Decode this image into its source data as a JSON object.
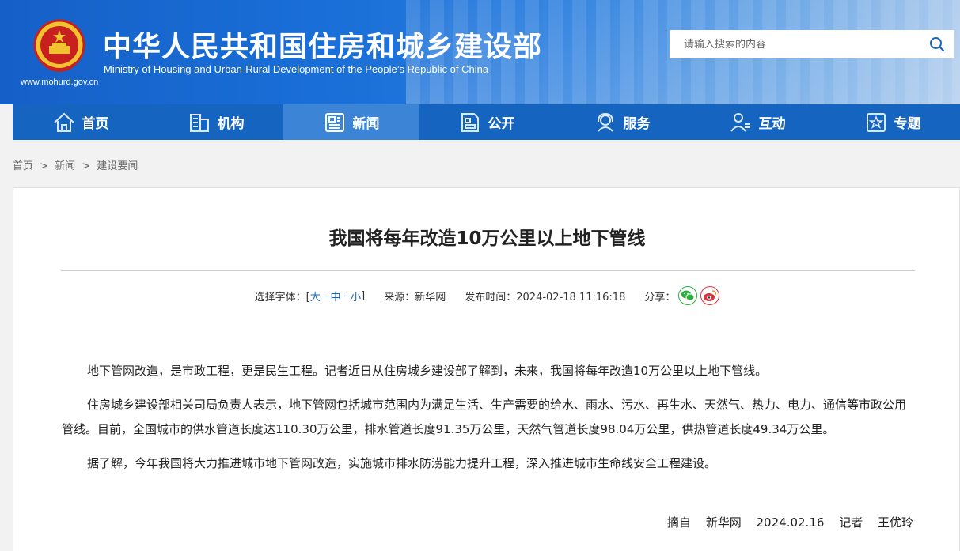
{
  "header": {
    "title_cn": "中华人民共和国住房和城乡建设部",
    "title_en": "Ministry of Housing and Urban-Rural Development of the People’s Republic of China",
    "url": "www.mohurd.gov.cn",
    "emblem_icon": "national-emblem-icon",
    "search_placeholder": "请输入搜索的内容",
    "search_icon": "search-icon"
  },
  "nav": {
    "items": [
      {
        "label": "首页",
        "icon": "home-icon"
      },
      {
        "label": "机构",
        "icon": "building-icon"
      },
      {
        "label": "新闻",
        "icon": "news-icon",
        "active": true
      },
      {
        "label": "公开",
        "icon": "document-icon"
      },
      {
        "label": "服务",
        "icon": "service-icon"
      },
      {
        "label": "互动",
        "icon": "interaction-icon"
      },
      {
        "label": "专题",
        "icon": "topic-icon"
      }
    ]
  },
  "breadcrumb": {
    "items": [
      "首页",
      "新闻",
      "建设要闻"
    ],
    "separator": ">"
  },
  "article": {
    "title": "我国将每年改造10万公里以上地下管线",
    "font_label": "选择字体：[",
    "font_large": "大",
    "font_medium": "中",
    "font_small": "小",
    "font_dash": "-",
    "font_close": "]",
    "source": "来源：新华网",
    "publish_time": "发布时间：2024-02-18 11:16:18",
    "share_label": "分享：",
    "paragraphs": [
      "地下管网改造，是市政工程，更是民生工程。记者近日从住房城乡建设部了解到，未来，我国将每年改造10万公里以上地下管线。",
      "住房城乡建设部相关司局负责人表示，地下管网包括城市范围内为满足生活、生产需要的给水、雨水、污水、再生水、天然气、热力、电力、通信等市政公用管线。目前，全国城市的供水管道长度达110.30万公里，排水管道长度91.35万公里，天然气管道长度98.04万公里，供热管道长度49.34万公里。",
      "据了解，今年我国将大力推进城市地下管网改造，实施城市排水防涝能力提升工程，深入推进城市生命线安全工程建设。"
    ],
    "sign": {
      "excerpt": "摘自",
      "source": "新华网",
      "date": "2024.02.16",
      "reporter_label": "记者",
      "reporter": "王优玲"
    }
  },
  "colors": {
    "nav_bg": "#1565c0",
    "nav_active": "#3b84d6",
    "wechat": "#2aae3c",
    "weibo": "#d9363e"
  }
}
